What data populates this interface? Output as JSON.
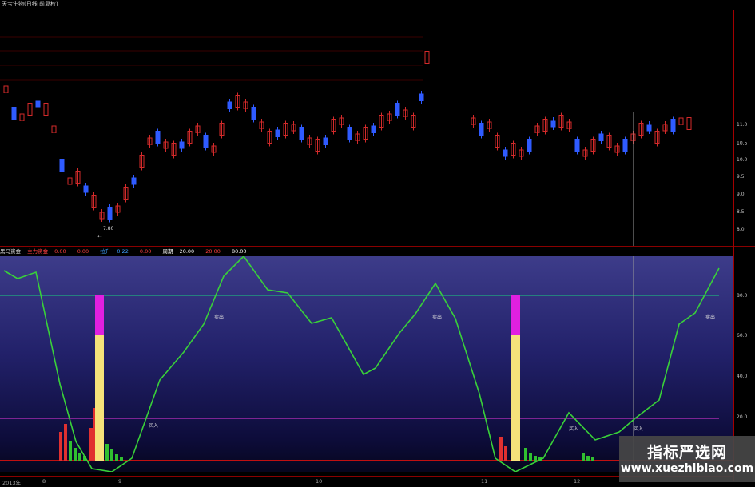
{
  "title": "天宝生物(日线 前复权)",
  "kchart": {
    "up_color": "#d42a2a",
    "down_color": "#2f5bff",
    "low_label": "7.80",
    "low_arrow": "←",
    "y_ticks": [
      "11.0",
      "10.5",
      "10.0",
      "9.5",
      "9.0",
      "8.5",
      "8.0"
    ]
  },
  "indicator": {
    "name": "黑马资金",
    "items": [
      {
        "label": "主力资金",
        "value": "0.00",
        "color": "#ff4040"
      },
      {
        "label": "",
        "value": "0.00",
        "color": "#ff4040"
      },
      {
        "label": "拉升",
        "value": "0.22",
        "color": "#40a0ff"
      },
      {
        "label": "",
        "value": "0.00",
        "color": "#ff4040"
      },
      {
        "label": "周期",
        "value": "20.00",
        "color": "#ffffff"
      },
      {
        "label": "",
        "value": "20.00",
        "color": "#ff4040"
      },
      {
        "label": "",
        "value": "80.00",
        "color": "#ffffff"
      }
    ],
    "y_ticks": [
      "80.0",
      "60.0",
      "40.0",
      "20.0"
    ],
    "annotations": {
      "high": "卖出",
      "low": "买入"
    },
    "line_color": "#39d139",
    "upper_level_color": "#20b080",
    "lower_level_color": "#c030c0"
  },
  "xaxis": {
    "labels": [
      "2013年",
      "8",
      "9",
      "10",
      "11",
      "12"
    ]
  },
  "watermark": {
    "name": "指标严选网",
    "url": "www.xuezhibiao.com"
  }
}
